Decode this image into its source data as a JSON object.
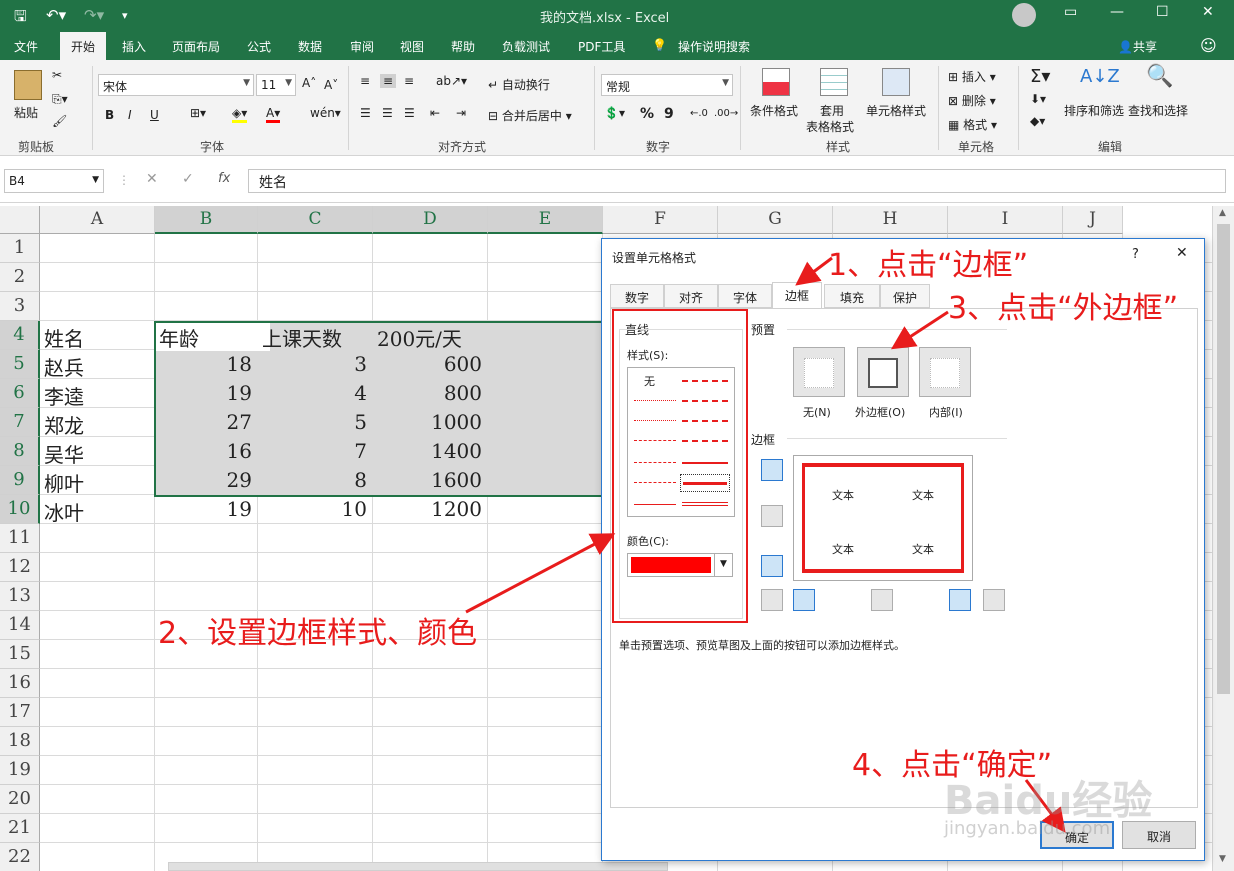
{
  "window": {
    "title": "我的文档.xlsx  -  Excel",
    "quick_access": [
      "save-icon",
      "undo-icon",
      "redo-icon",
      "customize-icon"
    ]
  },
  "menu": {
    "tabs": [
      "文件",
      "开始",
      "插入",
      "页面布局",
      "公式",
      "数据",
      "审阅",
      "视图",
      "帮助",
      "负载测试",
      "PDF工具",
      "操作说明搜索"
    ],
    "active": "开始",
    "share": "共享"
  },
  "ribbon": {
    "clipboard": {
      "paste": "粘贴",
      "label": "剪贴板"
    },
    "font": {
      "name": "宋体",
      "size": "11",
      "bold": "B",
      "italic": "I",
      "underline": "U",
      "label": "字体"
    },
    "alignment": {
      "wrap": "自动换行",
      "merge": "合并后居中",
      "label": "对齐方式"
    },
    "number": {
      "format": "常规",
      "percent": "%",
      "comma": "9",
      "label": "数字"
    },
    "styles": {
      "conditional": "条件格式",
      "table1": "套用",
      "table2": "表格格式",
      "cell": "单元格样式",
      "label": "样式"
    },
    "cells": {
      "insert": "插入",
      "delete": "删除",
      "format": "格式",
      "label": "单元格"
    },
    "editing": {
      "sort": "排序和筛选",
      "find": "查找和选择",
      "label": "编辑"
    }
  },
  "formula_bar": {
    "name_box": "B4",
    "content": "姓名",
    "fx": "fx"
  },
  "sheet": {
    "columns": [
      "A",
      "B",
      "C",
      "D",
      "E",
      "F",
      "G",
      "H",
      "I",
      "J"
    ],
    "rows": [
      "1",
      "2",
      "3",
      "4",
      "5",
      "6",
      "7",
      "8",
      "9",
      "10",
      "11",
      "12",
      "13",
      "14",
      "15",
      "16",
      "17",
      "18",
      "19",
      "20",
      "21",
      "22"
    ],
    "headers": [
      "姓名",
      "年龄",
      "上课天数",
      "200元/天"
    ],
    "data": [
      [
        "赵兵",
        "18",
        "3",
        "600"
      ],
      [
        "李逵",
        "19",
        "4",
        "800"
      ],
      [
        "郑龙",
        "27",
        "5",
        "1000"
      ],
      [
        "吴华",
        "16",
        "7",
        "1400"
      ],
      [
        "柳叶",
        "29",
        "8",
        "1600"
      ],
      [
        "冰叶",
        "19",
        "10",
        "1200"
      ]
    ]
  },
  "dialog": {
    "title": "设置单元格格式",
    "help": "?",
    "close": "✕",
    "tabs": [
      "数字",
      "对齐",
      "字体",
      "边框",
      "填充",
      "保护"
    ],
    "active_tab": "边框",
    "line_section": "直线",
    "style_label": "样式(S):",
    "style_none": "无",
    "color_label": "颜色(C):",
    "line_color": "#ff0000",
    "preset_section": "预置",
    "presets": [
      "无(N)",
      "外边框(O)",
      "内部(I)"
    ],
    "border_section": "边框",
    "preview_text": "文本",
    "hint": "单击预置选项、预览草图及上面的按钮可以添加边框样式。",
    "ok": "确定",
    "cancel": "取消"
  },
  "annotations": {
    "step1": "1、点击“边框”",
    "step2": "2、设置边框样式、颜色",
    "step3": "3、点击“外边框”",
    "step4": "4、点击“确定”",
    "color": "#e81c1c"
  },
  "watermark": {
    "line1": "Baidu经验",
    "line2": "jingyan.baidu.com"
  }
}
